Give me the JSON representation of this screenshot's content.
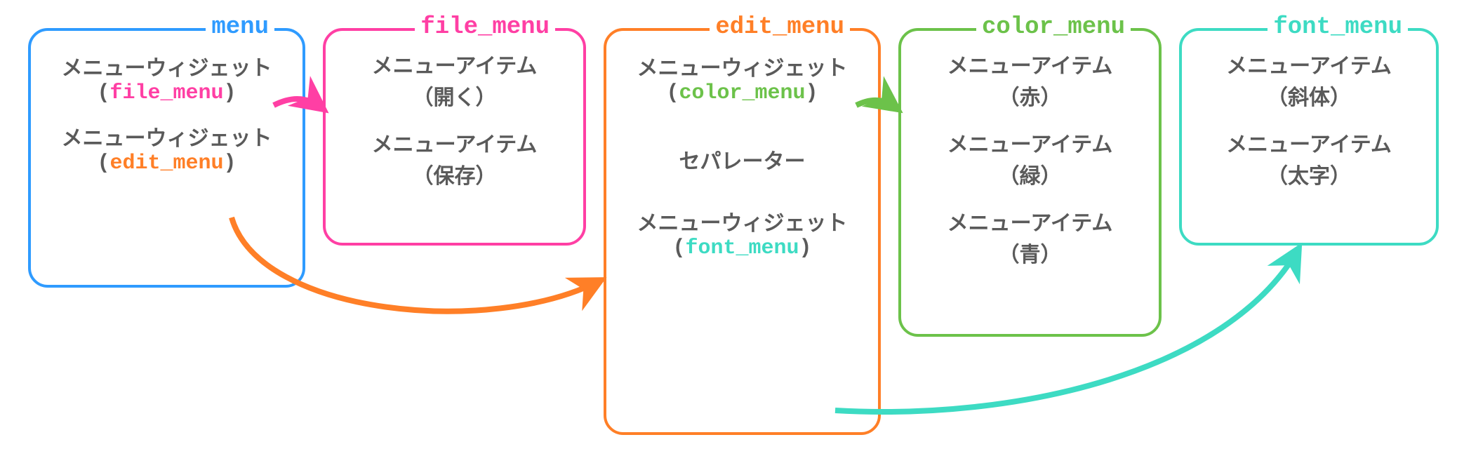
{
  "boxes": {
    "menu": {
      "title": "menu",
      "color": "#2f9bff",
      "widgets": [
        {
          "label": "メニューウィジェット",
          "ref": "file_menu",
          "ref_color": "#ff3fa4"
        },
        {
          "label": "メニューウィジェット",
          "ref": "edit_menu",
          "ref_color": "#ff7f27"
        }
      ]
    },
    "file_menu": {
      "title": "file_menu",
      "color": "#ff3fa4",
      "items": [
        {
          "label": "メニューアイテム",
          "sub": "（開く）"
        },
        {
          "label": "メニューアイテム",
          "sub": "（保存）"
        }
      ]
    },
    "edit_menu": {
      "title": "edit_menu",
      "color": "#ff7f27",
      "widgets": [
        {
          "label": "メニューウィジェット",
          "ref": "color_menu",
          "ref_color": "#6cc24a"
        }
      ],
      "separator": "セパレーター",
      "widgets2": [
        {
          "label": "メニューウィジェット",
          "ref": "font_menu",
          "ref_color": "#3ddbc3"
        }
      ]
    },
    "color_menu": {
      "title": "color_menu",
      "color": "#6cc24a",
      "items": [
        {
          "label": "メニューアイテム",
          "sub": "（赤）"
        },
        {
          "label": "メニューアイテム",
          "sub": "（緑）"
        },
        {
          "label": "メニューアイテム",
          "sub": "（青）"
        }
      ]
    },
    "font_menu": {
      "title": "font_menu",
      "color": "#3ddbc3",
      "items": [
        {
          "label": "メニューアイテム",
          "sub": "（斜体）"
        },
        {
          "label": "メニューアイテム",
          "sub": "（太字）"
        }
      ]
    }
  }
}
